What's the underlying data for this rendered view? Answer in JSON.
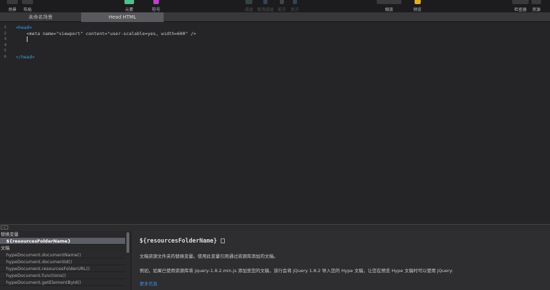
{
  "toolbar": {
    "items": [
      {
        "label": "场景",
        "disabled": false
      },
      {
        "label": "布局",
        "disabled": false
      },
      {
        "label": "元素",
        "disabled": false
      },
      {
        "label": "符号",
        "disabled": false
      },
      {
        "label": "成组",
        "disabled": true
      },
      {
        "label": "取消成组",
        "disabled": true
      },
      {
        "label": "前方",
        "disabled": true
      },
      {
        "label": "后方",
        "disabled": true
      },
      {
        "label": "缩放",
        "disabled": false
      },
      {
        "label": "预览",
        "disabled": false
      },
      {
        "label": "检查器",
        "disabled": false
      },
      {
        "label": "资源",
        "disabled": false
      }
    ]
  },
  "tabs": [
    {
      "label": "未命名场景"
    },
    {
      "label": "Head HTML"
    }
  ],
  "editor": {
    "lines": [
      {
        "n": "1",
        "text": "<head>"
      },
      {
        "n": "2",
        "text": "    <meta name=\"viewport\" content=\"user-scalable=yes, width=600\" />"
      },
      {
        "n": "3",
        "text": ""
      },
      {
        "n": "4",
        "text": ""
      },
      {
        "n": "5",
        "text": ""
      },
      {
        "n": "6",
        "text": "</head>"
      }
    ]
  },
  "list": {
    "group1": "替换变量",
    "selected": "${resourcesFolderName}",
    "group2": "文稿",
    "items": [
      "hypeDocument.documentName()",
      "hypeDocument.documentId()",
      "hypeDocument.resourcesFolderURL()",
      "hypeDocument.functions()",
      "hypeDocument.getElementById()"
    ]
  },
  "detail": {
    "title": "${resourcesFolderName}",
    "p1": "文稿资源文件夹的替换变量。使用此变量引用通过资源库添加的文稿。",
    "p2": "例如，如果已使用资源库将 jquery-1.8.2.min.js 添加至您的文稿，该行会将 jQuery 1.8.2 导入您的 Hype 文稿，让您在预览 Hype 文稿时可以使用 jQuery:",
    "more": "更多信息"
  }
}
